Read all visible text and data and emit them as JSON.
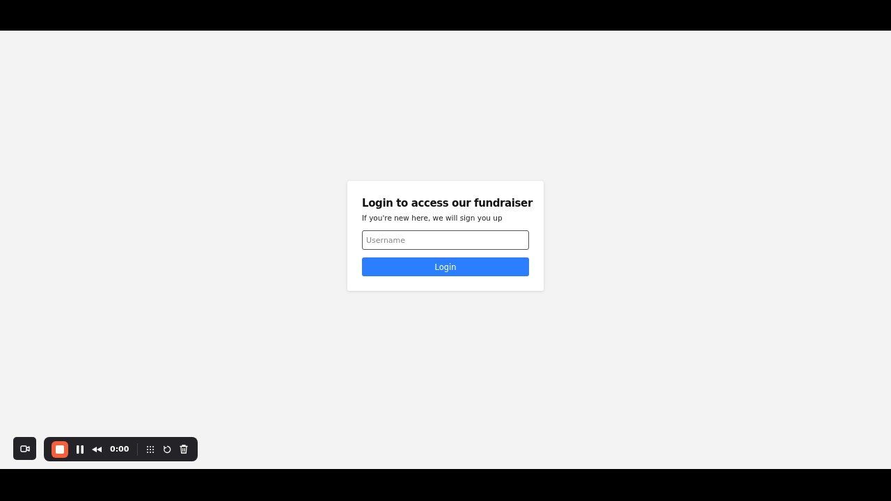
{
  "login_card": {
    "title": "Login to access our fundraiser",
    "subtitle": "If you're new here, we will sign you up",
    "username_field": {
      "placeholder": "Username"
    },
    "button": "Login"
  },
  "recorder_toolbar": {
    "timer": "0:00"
  }
}
